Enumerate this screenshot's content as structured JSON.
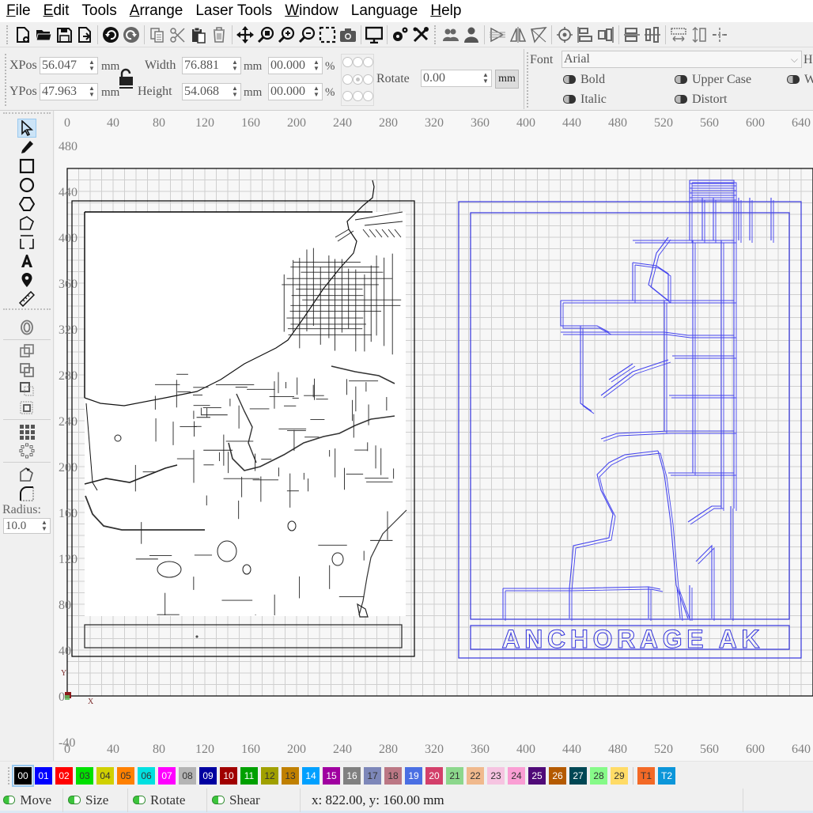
{
  "menu": [
    {
      "label": "File",
      "mnemonic": "F",
      "rest": "ile"
    },
    {
      "label": "Edit",
      "mnemonic": "E",
      "rest": "dit"
    },
    {
      "label": "Tools",
      "mnemonic": "",
      "rest": "Tools"
    },
    {
      "label": "Arrange",
      "mnemonic": "A",
      "rest": "rrange"
    },
    {
      "label": "Laser Tools",
      "mnemonic": "",
      "rest": "Laser Tools"
    },
    {
      "label": "Window",
      "mnemonic": "W",
      "rest": "indow"
    },
    {
      "label": "Language",
      "mnemonic": "",
      "rest": "Language"
    },
    {
      "label": "Help",
      "mnemonic": "H",
      "rest": "elp"
    }
  ],
  "toolbar": {
    "groups": [
      [
        "new-file-icon",
        "open-folder-icon",
        "save-icon",
        "import-icon"
      ],
      [
        "undo-icon",
        "redo-icon"
      ],
      [
        "copy-icon",
        "cut-icon",
        "paste-icon",
        "delete-icon"
      ],
      [
        "move-icon",
        "zoom-fit-icon",
        "zoom-in-icon",
        "zoom-out-icon",
        "select-area-icon",
        "camera-icon"
      ],
      [
        "monitor-icon"
      ],
      [
        "settings-icon",
        "tools-icon"
      ],
      [
        "group-icon",
        "ungroup-icon"
      ],
      [
        "flip-horizontal-icon",
        "mirror-icon",
        "mirror-vertical-icon"
      ],
      [
        "center-target-icon",
        "align-left-icon",
        "align-right-icon"
      ],
      [
        "align-top-icon",
        "align-vertical-center-icon"
      ],
      [
        "distribute-horizontal-icon",
        "distribute-vertical-icon",
        "distribute-center-icon"
      ]
    ]
  },
  "properties": {
    "xpos_label": "XPos",
    "xpos_value": "56.047",
    "ypos_label": "YPos",
    "ypos_value": "47.963",
    "unit_mm": "mm",
    "width_label": "Width",
    "width_value": "76.881",
    "height_label": "Height",
    "height_value": "54.068",
    "scale_x_value": "00.000",
    "scale_y_value": "00.000",
    "percent": "%",
    "rotate_label": "Rotate",
    "rotate_value": "0.00",
    "unit_button": "mm",
    "font_label": "Font",
    "font_value": "Arial",
    "height_short": "He",
    "bold_label": "Bold",
    "italic_label": "Italic",
    "upper_case_label": "Upper Case",
    "distort_label": "Distort",
    "weld_short": "W"
  },
  "left_tools": {
    "radius_label": "Radius:",
    "radius_value": "10.0"
  },
  "canvas": {
    "x_ticks": [
      "0",
      "40",
      "80",
      "120",
      "160",
      "200",
      "240",
      "280",
      "320",
      "360",
      "400",
      "440",
      "480",
      "520",
      "560",
      "600",
      "640"
    ],
    "y_ticks": [
      "480",
      "440",
      "400",
      "360",
      "320",
      "280",
      "240",
      "200",
      "160",
      "120",
      "80",
      "40",
      "0",
      "-40"
    ],
    "axis_x": "X",
    "axis_y": "Y",
    "right_title_text": "ANCHORAGE AK",
    "left_color": "#000000",
    "right_color": "#3333dd"
  },
  "palette": [
    {
      "label": "00",
      "bg": "#000000",
      "fg": "#ffffff"
    },
    {
      "label": "01",
      "bg": "#0000ff",
      "fg": "#ffffff"
    },
    {
      "label": "02",
      "bg": "#ff0000",
      "fg": "#ffffff"
    },
    {
      "label": "03",
      "bg": "#00e000",
      "fg": "#333333"
    },
    {
      "label": "04",
      "bg": "#d0d000",
      "fg": "#333333"
    },
    {
      "label": "05",
      "bg": "#ff8000",
      "fg": "#333333"
    },
    {
      "label": "06",
      "bg": "#00e0e0",
      "fg": "#333333"
    },
    {
      "label": "07",
      "bg": "#ff00ff",
      "fg": "#ffffff"
    },
    {
      "label": "08",
      "bg": "#b4b4b4",
      "fg": "#333333"
    },
    {
      "label": "09",
      "bg": "#0000a0",
      "fg": "#ffffff"
    },
    {
      "label": "10",
      "bg": "#a00000",
      "fg": "#ffffff"
    },
    {
      "label": "11",
      "bg": "#00a000",
      "fg": "#ffffff"
    },
    {
      "label": "12",
      "bg": "#a0a000",
      "fg": "#333333"
    },
    {
      "label": "13",
      "bg": "#c08000",
      "fg": "#333333"
    },
    {
      "label": "14",
      "bg": "#00a0ff",
      "fg": "#ffffff"
    },
    {
      "label": "15",
      "bg": "#a000a0",
      "fg": "#ffffff"
    },
    {
      "label": "16",
      "bg": "#808080",
      "fg": "#ffffff"
    },
    {
      "label": "17",
      "bg": "#7d87b9",
      "fg": "#333333"
    },
    {
      "label": "18",
      "bg": "#bb7784",
      "fg": "#333333"
    },
    {
      "label": "19",
      "bg": "#4a6fe3",
      "fg": "#ffffff"
    },
    {
      "label": "20",
      "bg": "#d33f6a",
      "fg": "#ffffff"
    },
    {
      "label": "21",
      "bg": "#8cd78c",
      "fg": "#333333"
    },
    {
      "label": "22",
      "bg": "#f0b98d",
      "fg": "#333333"
    },
    {
      "label": "23",
      "bg": "#f6c4e1",
      "fg": "#333333"
    },
    {
      "label": "24",
      "bg": "#fa9ed4",
      "fg": "#333333"
    },
    {
      "label": "25",
      "bg": "#500a78",
      "fg": "#ffffff"
    },
    {
      "label": "26",
      "bg": "#b45a00",
      "fg": "#ffffff"
    },
    {
      "label": "27",
      "bg": "#004754",
      "fg": "#ffffff"
    },
    {
      "label": "28",
      "bg": "#86fa88",
      "fg": "#333333"
    },
    {
      "label": "29",
      "bg": "#ffdb66",
      "fg": "#333333"
    },
    {
      "label": "T1",
      "bg": "#f36926",
      "fg": "#333333"
    },
    {
      "label": "T2",
      "bg": "#0c96d9",
      "fg": "#ffffff"
    }
  ],
  "status": {
    "move_label": "Move",
    "size_label": "Size",
    "rotate_label": "Rotate",
    "shear_label": "Shear",
    "coords": "x: 822.00,  y: 160.00 mm"
  }
}
